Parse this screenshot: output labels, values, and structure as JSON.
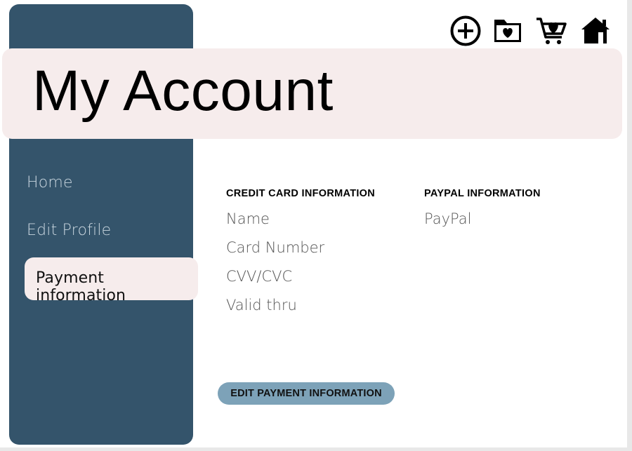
{
  "page": {
    "title": "My Account"
  },
  "sidebar": {
    "items": [
      {
        "label": "Home"
      },
      {
        "label": "Edit Profile"
      },
      {
        "label": "Payment information",
        "active": true
      }
    ]
  },
  "toolbar": {
    "icons": [
      "add-circle-icon",
      "favorites-folder-icon",
      "cart-heart-icon",
      "home-icon"
    ]
  },
  "credit_card": {
    "heading": "CREDIT CARD INFORMATION",
    "fields": [
      "Name",
      "Card Number",
      "CVV/CVC",
      "Valid thru"
    ]
  },
  "paypal": {
    "heading": "PAYPAL INFORMATION",
    "fields": [
      "PayPal"
    ]
  },
  "actions": {
    "edit_label": "EDIT PAYMENT INFORMATION"
  },
  "colors": {
    "sidebar": "#34546b",
    "highlight": "#f6ecec",
    "button": "#7da2b8"
  }
}
